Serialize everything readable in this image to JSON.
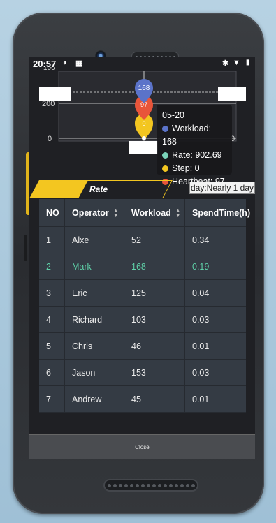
{
  "statusbar": {
    "time": "20:57"
  },
  "chart_data": {
    "type": "line",
    "yticks": [
      "200",
      "0"
    ],
    "ytick_top_partial": "100",
    "point_labels": [
      "168",
      "97",
      "0"
    ],
    "tooltip": {
      "date": "05-20",
      "series": [
        {
          "name": "Workload",
          "value": "168",
          "color": "#5b73c9"
        },
        {
          "name": "Rate",
          "value": "902.69",
          "color": "#7ad3b8"
        },
        {
          "name": "Step",
          "value": "0",
          "color": "#f3c620"
        },
        {
          "name": "Heartbeat",
          "value": "97",
          "color": "#e8553a"
        }
      ]
    },
    "right_axis_label": "0"
  },
  "tabs": {
    "rate_label": "Rate",
    "day_filter": "day:Nearly 1 day"
  },
  "table": {
    "headers": [
      "NO",
      "Operator",
      "Workload",
      "SpendTime(h)"
    ],
    "rows": [
      [
        "1",
        "Alxe",
        "52",
        "0.34"
      ],
      [
        "2",
        "Mark",
        "168",
        "0.19"
      ],
      [
        "3",
        "Eric",
        "125",
        "0.04"
      ],
      [
        "4",
        "Richard",
        "103",
        "0.03"
      ],
      [
        "5",
        "Chris",
        "46",
        "0.01"
      ],
      [
        "6",
        "Jason",
        "153",
        "0.03"
      ],
      [
        "7",
        "Andrew",
        "45",
        "0.01"
      ]
    ]
  },
  "footer": {
    "close_label": "Close"
  },
  "colors": {
    "accent": "#f3c620",
    "selected_row": "#5fd1a8",
    "table_bg": "#343b44"
  }
}
